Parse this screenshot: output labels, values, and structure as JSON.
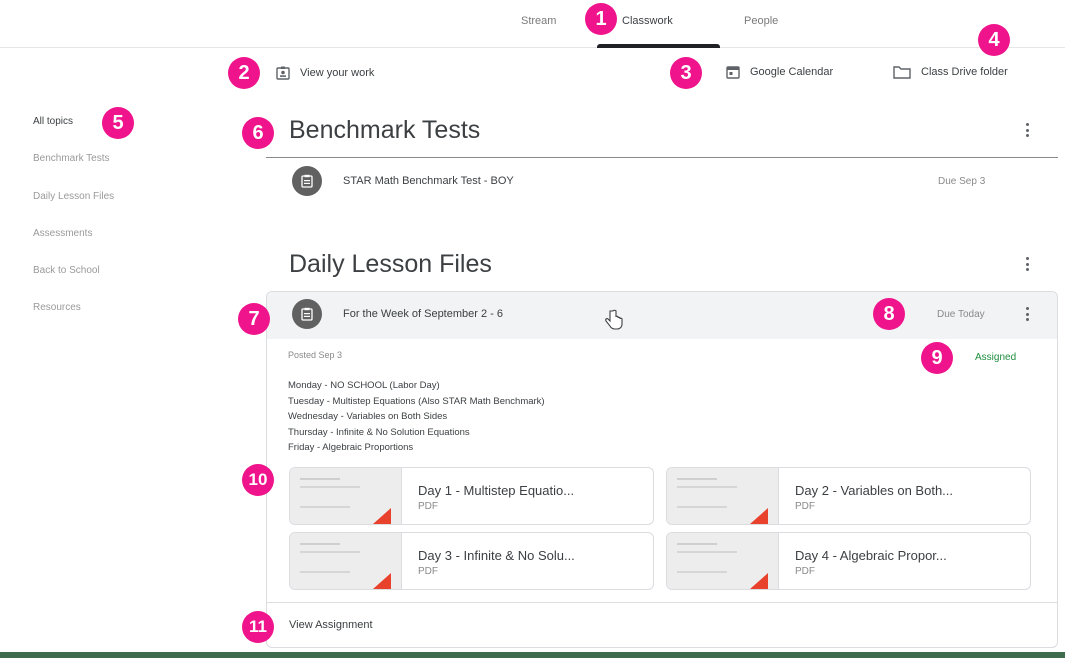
{
  "tabs": [
    {
      "label": "Stream"
    },
    {
      "label": "Classwork",
      "active": true
    },
    {
      "label": "People"
    }
  ],
  "actions": {
    "view_work": "View your work",
    "calendar": "Google Calendar",
    "drive": "Class Drive folder"
  },
  "sidebar": {
    "items": [
      {
        "label": "All topics",
        "active": true
      },
      {
        "label": "Benchmark Tests"
      },
      {
        "label": "Daily Lesson Files"
      },
      {
        "label": "Assessments"
      },
      {
        "label": "Back to School"
      },
      {
        "label": "Resources"
      }
    ]
  },
  "topics": [
    {
      "title": "Benchmark Tests",
      "items": [
        {
          "title": "STAR Math Benchmark Test - BOY",
          "due": "Due Sep 3"
        }
      ]
    },
    {
      "title": "Daily Lesson Files",
      "items": [
        {
          "title": "For the Week of September 2 - 6",
          "due": "Due Today",
          "posted": "Posted Sep 3",
          "status": "Assigned",
          "description": [
            "Monday - NO SCHOOL (Labor Day)",
            "Tuesday - Multistep Equations (Also STAR Math Benchmark)",
            "Wednesday - Variables on Both Sides",
            "Thursday - Infinite & No Solution Equations",
            "Friday - Algebraic Proportions"
          ],
          "attachments": [
            {
              "title": "Day 1 - Multistep Equatio...",
              "type": "PDF"
            },
            {
              "title": "Day 2 - Variables on Both...",
              "type": "PDF"
            },
            {
              "title": "Day 3 - Infinite & No Solu...",
              "type": "PDF"
            },
            {
              "title": "Day 4 - Algebraic Propor...",
              "type": "PDF"
            }
          ],
          "view_label": "View Assignment"
        }
      ]
    }
  ],
  "badges": [
    "1",
    "2",
    "3",
    "4",
    "5",
    "6",
    "7",
    "8",
    "9",
    "10",
    "11"
  ],
  "colors": {
    "badge": "#f0148c",
    "assigned": "#1e8e3e",
    "active_tab_underline": "#202124",
    "pdf_corner": "#e8412c"
  }
}
